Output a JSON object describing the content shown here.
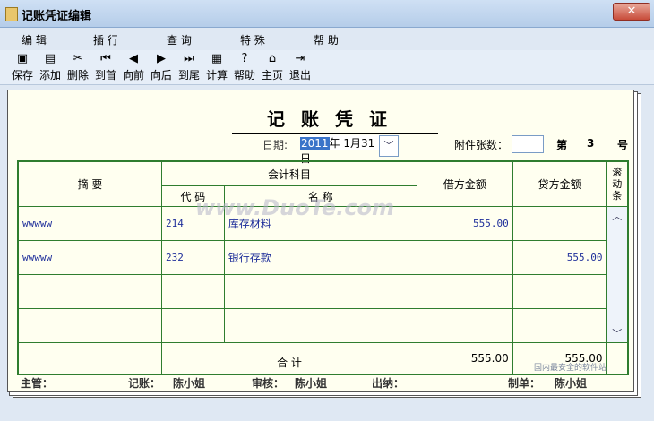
{
  "window": {
    "title": "记账凭证编辑",
    "close_glyph": "✕"
  },
  "menu": [
    "编 辑",
    "插 行",
    "查 询",
    "特 殊",
    "帮 助"
  ],
  "toolbar": [
    {
      "label": "保存",
      "icon": "save-icon",
      "glyph": "▣"
    },
    {
      "label": "添加",
      "icon": "add-icon",
      "glyph": "▤"
    },
    {
      "label": "删除",
      "icon": "delete-icon",
      "glyph": "✂"
    },
    {
      "label": "到首",
      "icon": "first-icon",
      "glyph": "⏮"
    },
    {
      "label": "向前",
      "icon": "prev-icon",
      "glyph": "◀"
    },
    {
      "label": "向后",
      "icon": "next-icon",
      "glyph": "▶"
    },
    {
      "label": "到尾",
      "icon": "last-icon",
      "glyph": "⏭"
    },
    {
      "label": "计算",
      "icon": "calculator-icon",
      "glyph": "▦"
    },
    {
      "label": "帮助",
      "icon": "help-icon",
      "glyph": "?"
    },
    {
      "label": "主页",
      "icon": "home-icon",
      "glyph": "⌂"
    },
    {
      "label": "退出",
      "icon": "exit-icon",
      "glyph": "⇥"
    }
  ],
  "voucher": {
    "title": "记账凭证",
    "date_label": "日期:",
    "date_year": "2011",
    "date_rest": "年 1月31日",
    "attachments_label": "附件张数：",
    "attachments_value": "",
    "page_label": "第",
    "page_value": "3",
    "page_suffix": "号"
  },
  "table": {
    "headers": {
      "summary": "摘 要",
      "account": "会计科目",
      "code": "代 码",
      "name": "名 称",
      "debit": "借方金额",
      "credit": "贷方金额",
      "scroll": "滚动条"
    },
    "rows": [
      {
        "summary": "wwwww",
        "code": "214",
        "name": "库存材料",
        "debit": "555.00",
        "credit": ""
      },
      {
        "summary": "wwwww",
        "code": "232",
        "name": "银行存款",
        "debit": "",
        "credit": "555.00"
      },
      {
        "summary": "",
        "code": "",
        "name": "",
        "debit": "",
        "credit": ""
      },
      {
        "summary": "",
        "code": "",
        "name": "",
        "debit": "",
        "credit": ""
      }
    ],
    "total_label": "合 计",
    "total_debit": "555.00",
    "total_credit": "555.00"
  },
  "footer": {
    "supervisor_label": "主管：",
    "bookkeeper_label": "记账：",
    "bookkeeper": "陈小姐",
    "reviewer_label": "审核：",
    "reviewer": "陈小姐",
    "cashier_label": "出纳：",
    "maker_label": "制单：",
    "maker": "陈小姐"
  },
  "watermark": "www.DuoTe.com",
  "corner_mark": "国内最安全的软件站"
}
